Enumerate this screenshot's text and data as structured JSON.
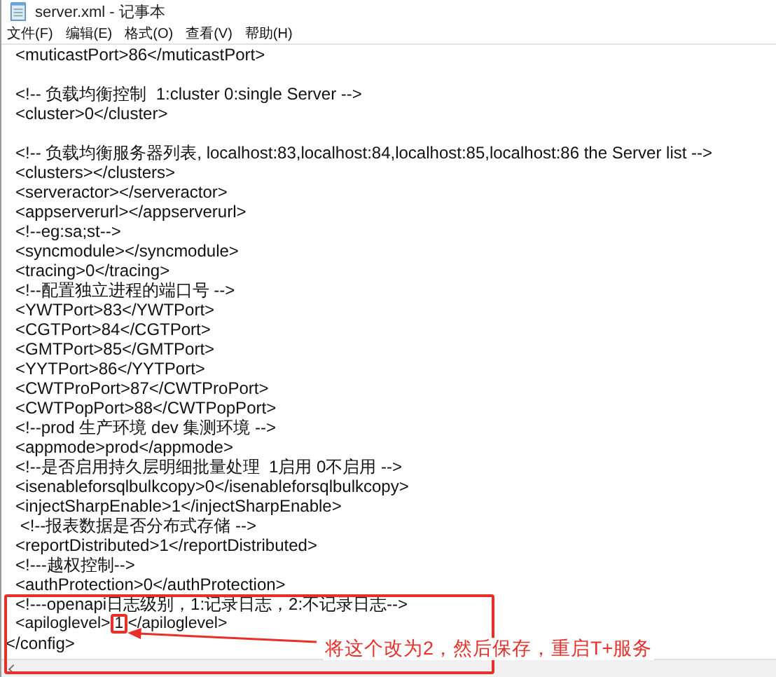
{
  "window": {
    "title": "server.xml - 记事本"
  },
  "menu": [
    {
      "label": "文件(F)"
    },
    {
      "label": "编辑(E)"
    },
    {
      "label": "格式(O)"
    },
    {
      "label": "查看(V)"
    },
    {
      "label": "帮助(H)"
    }
  ],
  "editor": {
    "lines": [
      {
        "kind": "text",
        "text": "<muticastPort>86</muticastPort>"
      },
      {
        "kind": "blank"
      },
      {
        "kind": "text",
        "text": "<!-- 负载均衡控制  1:cluster 0:single Server -->"
      },
      {
        "kind": "text",
        "text": "<cluster>0</cluster>"
      },
      {
        "kind": "blank"
      },
      {
        "kind": "text",
        "text": "<!-- 负载均衡服务器列表, localhost:83,localhost:84,localhost:85,localhost:86 the Server list -->"
      },
      {
        "kind": "text",
        "text": "<clusters></clusters>"
      },
      {
        "kind": "text",
        "text": "<serveractor></serveractor>"
      },
      {
        "kind": "text",
        "text": "<appserverurl></appserverurl>"
      },
      {
        "kind": "text",
        "text": "<!--eg:sa;st-->"
      },
      {
        "kind": "text",
        "text": "<syncmodule></syncmodule>"
      },
      {
        "kind": "text",
        "text": "<tracing>0</tracing>"
      },
      {
        "kind": "text",
        "text": "<!--配置独立进程的端口号 -->"
      },
      {
        "kind": "text",
        "text": "<YWTPort>83</YWTPort>"
      },
      {
        "kind": "text",
        "text": "<CGTPort>84</CGTPort>"
      },
      {
        "kind": "text",
        "text": "<GMTPort>85</GMTPort>"
      },
      {
        "kind": "text",
        "text": "<YYTPort>86</YYTPort>"
      },
      {
        "kind": "text",
        "text": "<CWTProPort>87</CWTProPort>"
      },
      {
        "kind": "text",
        "text": "<CWTPopPort>88</CWTPopPort>"
      },
      {
        "kind": "text",
        "text": "<!--prod 生产环境 dev 集测环境 -->"
      },
      {
        "kind": "text",
        "text": "<appmode>prod</appmode>"
      },
      {
        "kind": "text",
        "text": "<!--是否启用持久层明细批量处理  1启用 0不启用 -->"
      },
      {
        "kind": "text",
        "text": "<isenableforsqlbulkcopy>0</isenableforsqlbulkcopy>"
      },
      {
        "kind": "text",
        "text": "<injectSharpEnable>1</injectSharpEnable>"
      },
      {
        "kind": "text",
        "text": " <!--报表数据是否分布式存储 -->"
      },
      {
        "kind": "text",
        "text": "<reportDistributed>1</reportDistributed>"
      },
      {
        "kind": "text",
        "text": "<!---越权控制-->"
      },
      {
        "kind": "text",
        "text": "<authProtection>0</authProtection>"
      },
      {
        "kind": "text",
        "text": "<!---openapi日志级别，1:记录日志，2:不记录日志-->"
      },
      {
        "kind": "highlight",
        "before": "<apiloglevel>",
        "value": "1",
        "after": "</apiloglevel>"
      },
      {
        "kind": "closing",
        "text": "</config>"
      }
    ]
  },
  "annotation": {
    "note": "将这个改为2，然后保存，重启T+服务"
  }
}
